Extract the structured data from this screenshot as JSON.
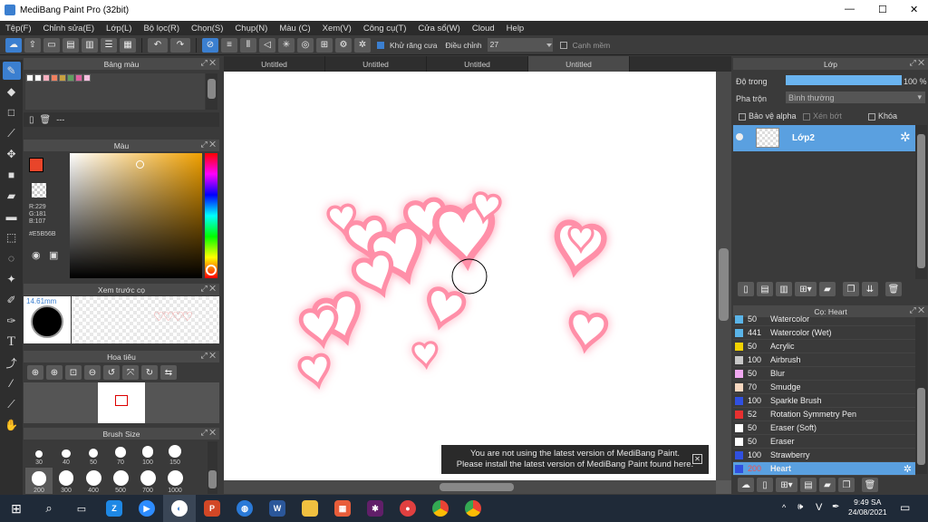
{
  "app": {
    "title": "MediBang Paint Pro (32bit)",
    "min": "—",
    "max": "☐",
    "close": "✕"
  },
  "menu": [
    "Tệp(F)",
    "Chỉnh sửa(E)",
    "Lớp(L)",
    "Bộ lọc(R)",
    "Chọn(S)",
    "Chụp(N)",
    "Màu (C)",
    "Xem(V)",
    "Công cụ(T)",
    "Cửa sổ(W)",
    "Cloud",
    "Help"
  ],
  "toolbar": {
    "antialias_label": "Khử răng cưa",
    "adjust_label": "Điều chỉnh",
    "adjust_value": "27",
    "smooth_label": "Cạnh mềm"
  },
  "panels": {
    "palette": "Bảng màu",
    "color": "Màu",
    "preview": "Xem trước cọ",
    "navigator": "Hoa tiêu",
    "brush_size": "Brush Size",
    "layer": "Lớp",
    "brush": "Cọ: Heart"
  },
  "palette_colors": [
    "#ffffff",
    "#ffffff",
    "#f8b0c0",
    "#f08060",
    "#c8a040",
    "#60a060",
    "#e060a0",
    "#f8c0e0"
  ],
  "palette_extra": "---",
  "color": {
    "r": "R:229",
    "g": "G:181",
    "b": "B:107",
    "hex": "#E5B56B",
    "main": "#e8452a"
  },
  "preview_size": "14.61mm",
  "brush_sizes": [
    "30",
    "40",
    "50",
    "70",
    "100",
    "150",
    "200",
    "300",
    "400",
    "500",
    "700",
    "1000"
  ],
  "doc_tabs": [
    "Untitled",
    "Untitled",
    "Untitled",
    "Untitled"
  ],
  "toast": {
    "line1": "You are not using the latest version of MediBang Paint.",
    "line2": "Please install the latest version of MediBang Paint found here."
  },
  "layer": {
    "opacity_label": "Độ trong",
    "opacity_value": "100 %",
    "opacity": 1.0,
    "blend_label": "Pha trộn",
    "blend_value": "Bình thường",
    "protect_alpha": "Bảo vệ alpha",
    "clip": "Xén bớt",
    "lock": "Khóa",
    "name": "Lớp2"
  },
  "brushes": [
    {
      "size": "50",
      "name": "Watercolor",
      "color": "#5ab4e8"
    },
    {
      "size": "441",
      "name": "Watercolor (Wet)",
      "color": "#5ab4e8"
    },
    {
      "size": "50",
      "name": "Acrylic",
      "color": "#f2d200"
    },
    {
      "size": "100",
      "name": "Airbrush",
      "color": "#c8c8c8"
    },
    {
      "size": "50",
      "name": "Blur",
      "color": "#f0a8f0"
    },
    {
      "size": "70",
      "name": "Smudge",
      "color": "#f8d8c0"
    },
    {
      "size": "100",
      "name": "Sparkle Brush",
      "color": "#3050e0"
    },
    {
      "size": "52",
      "name": "Rotation Symmetry Pen",
      "color": "#e83030"
    },
    {
      "size": "50",
      "name": "Eraser (Soft)",
      "color": "#ffffff"
    },
    {
      "size": "50",
      "name": "Eraser",
      "color": "#ffffff"
    },
    {
      "size": "100",
      "name": "Strawberry",
      "color": "#3050e0"
    },
    {
      "size": "200",
      "name": "Heart",
      "color": "#3050e0"
    }
  ],
  "taskbar": {
    "time": "9:49 SA",
    "date": "24/08/2021",
    "lang": "V"
  }
}
